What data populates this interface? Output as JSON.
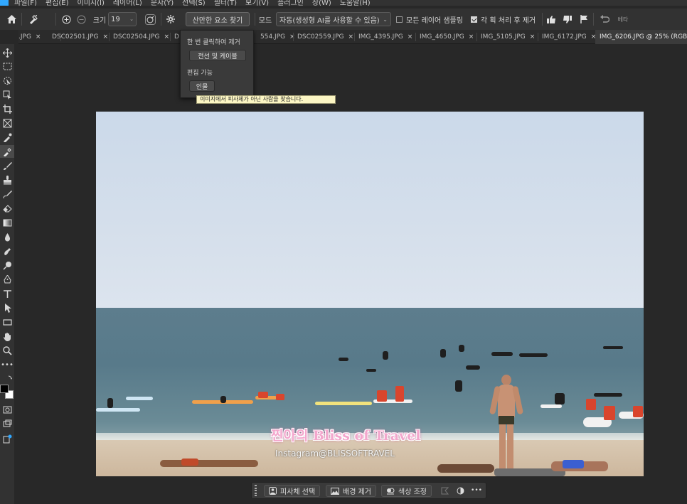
{
  "app": {
    "menu_items": [
      "파일(F)",
      "편집(E)",
      "이미지(I)",
      "레이어(L)",
      "문자(Y)",
      "선택(S)",
      "필터(T)",
      "보기(V)",
      "플러그인",
      "창(W)",
      "도움말(H)"
    ]
  },
  "options": {
    "size_label": "크기",
    "size_value": "19",
    "find_distractions_label": "산만한 요소 찾기",
    "mode_label": "모드",
    "mode_value": "자동(생성형 AI를 사용할 수 있음)",
    "sample_all_layers_label": "모든 레이어 샘플링",
    "sample_all_layers_checked": false,
    "remove_after_stroke_label": "각 획 처리 후 제거",
    "remove_after_stroke_checked": true,
    "beta_label": "베타"
  },
  "tabs": [
    {
      "label": ".JPG",
      "active": false
    },
    {
      "label": "DSC02501.JPG",
      "active": false
    },
    {
      "label": "DSC02504.JPG",
      "active": false
    },
    {
      "label": "D",
      "active": false
    },
    {
      "label": "554.JPG",
      "active": false
    },
    {
      "label": "DSC02559.JPG",
      "active": false
    },
    {
      "label": "IMG_4395.JPG",
      "active": false
    },
    {
      "label": "IMG_4650.JPG",
      "active": false
    },
    {
      "label": "IMG_5105.JPG",
      "active": false
    },
    {
      "label": "IMG_6172.JPG",
      "active": false
    },
    {
      "label": "IMG_6206.JPG @ 25% (RGB/8",
      "active": true
    }
  ],
  "popup": {
    "section1_label": "한 번 클릭하여 제거",
    "wires_button": "전선 및 케이블",
    "section2_label": "편집 가능",
    "people_button": "인물",
    "tooltip": "이미지에서 피사체가 아닌 사람을 찾습니다."
  },
  "photo": {
    "watermark_title": "찐아의 Bliss of Travel",
    "watermark_instagram": "Instagram@BLISSOFTRAVEL"
  },
  "taskbar": {
    "select_subject": "피사체 선택",
    "remove_background": "배경 제거",
    "color_adjust": "색상 조정",
    "more": "•••"
  },
  "colors": {
    "accent": "#31a8ff",
    "tooltip_bg": "#fcf6c4",
    "watermark_pink": "#f3a7cd"
  },
  "tools": [
    "move-icon",
    "marquee-icon",
    "object-select-icon",
    "crop-select-icon",
    "crop-icon",
    "frame-icon",
    "eyedropper-icon",
    "healing-brush-icon",
    "brush-icon",
    "stamp-icon",
    "history-brush-icon",
    "eraser-icon",
    "gradient-icon",
    "blur-icon",
    "smudge-icon",
    "dodge-icon",
    "pen-icon",
    "type-icon",
    "path-select-icon",
    "rectangle-icon",
    "hand-icon",
    "zoom-icon",
    "more-tools-icon"
  ]
}
